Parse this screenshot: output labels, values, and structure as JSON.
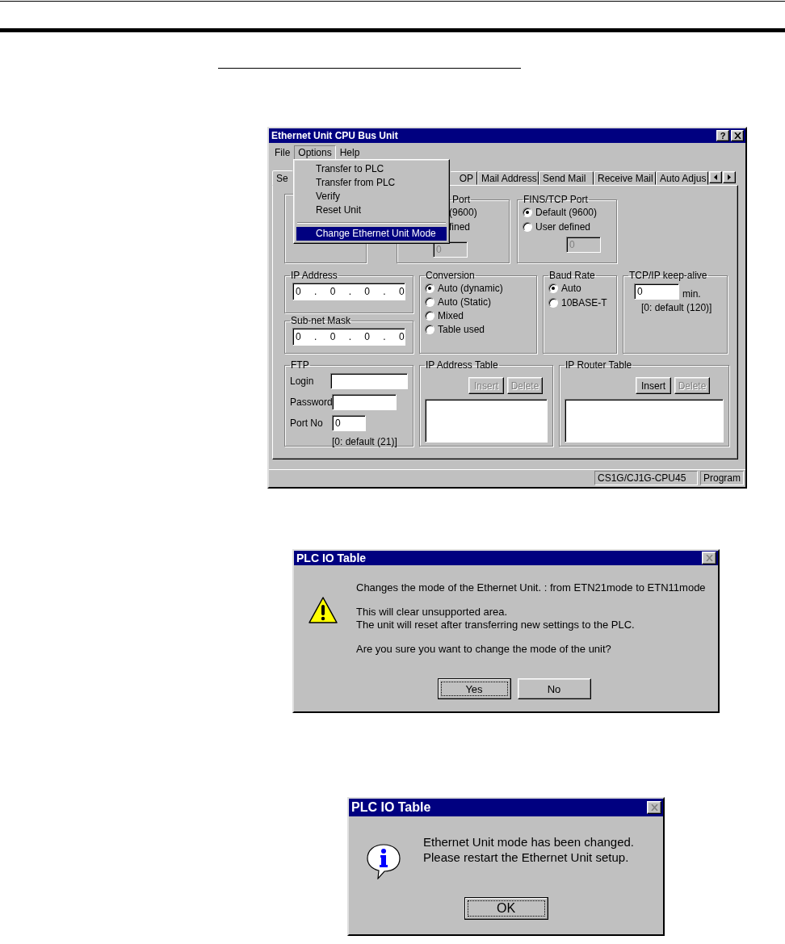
{
  "main_window": {
    "title": "Ethernet Unit CPU Bus Unit",
    "help_button": "?",
    "menu": [
      {
        "label": "File",
        "selected": false
      },
      {
        "label": "Options",
        "selected": true
      },
      {
        "label": "Help",
        "selected": false
      }
    ],
    "options_menu": [
      {
        "kind": "item",
        "label": "Transfer to PLC",
        "selected": false
      },
      {
        "kind": "item",
        "label": "Transfer from PLC",
        "selected": false
      },
      {
        "kind": "item",
        "label": "Verify",
        "selected": false
      },
      {
        "kind": "item",
        "label": "Reset Unit",
        "selected": false
      },
      {
        "kind": "separator"
      },
      {
        "kind": "item",
        "label": "Change Ethernet Unit Mode",
        "selected": true
      }
    ],
    "tabs": [
      {
        "label": "Se",
        "selected": true
      },
      {
        "label": "OP",
        "selected": false
      },
      {
        "label": "Mail Address",
        "selected": false
      },
      {
        "label": "Send Mail",
        "selected": false
      },
      {
        "label": "Receive Mail",
        "selected": false
      },
      {
        "label": "Auto Adjus",
        "selected": false
      }
    ],
    "port_group": {
      "label": "Port",
      "options": [
        "(9600)",
        "fined"
      ],
      "field": {
        "value": "0",
        "disabled": true
      }
    },
    "fins_tcp_port": {
      "label": "FINS/TCP Port",
      "options": [
        {
          "label": "Default (9600)",
          "checked": true
        },
        {
          "label": "User defined",
          "checked": false
        }
      ],
      "field": {
        "value": "0",
        "disabled": true
      }
    },
    "ip_address": {
      "label": "IP Address",
      "value": "0 . 0 . 0 . 0"
    },
    "subnet_mask": {
      "label": "Sub-net Mask",
      "value": "0 . 0 . 0 . 0"
    },
    "conversion": {
      "label": "Conversion",
      "options": [
        {
          "label": "Auto (dynamic)",
          "checked": true
        },
        {
          "label": "Auto (Static)",
          "checked": false
        },
        {
          "label": "Mixed",
          "checked": false
        },
        {
          "label": "Table used",
          "checked": false
        }
      ]
    },
    "baud_rate": {
      "label": "Baud Rate",
      "options": [
        {
          "label": "Auto",
          "checked": true
        },
        {
          "label": "10BASE-T",
          "checked": false
        }
      ]
    },
    "keep_alive": {
      "label": "TCP/IP keep-alive",
      "value": "0",
      "unit": "min.",
      "note": "[0: default (120)]"
    },
    "ftp": {
      "label": "FTP",
      "fields": [
        {
          "label": "Login"
        },
        {
          "label": "Password"
        },
        {
          "label": "Port No",
          "value": "0"
        }
      ],
      "note": "[0: default (21)]"
    },
    "ip_address_table": {
      "label": "IP Address Table",
      "buttons": [
        {
          "label": "Insert",
          "disabled": true
        },
        {
          "label": "Delete",
          "disabled": true
        }
      ]
    },
    "ip_router_table": {
      "label": "IP Router Table",
      "buttons": [
        {
          "label": "Insert",
          "disabled": false
        },
        {
          "label": "Delete",
          "disabled": true
        }
      ]
    },
    "status_bar": [
      "CS1G/CJ1G-CPU45",
      "Program"
    ]
  },
  "confirm_dialog": {
    "title": "PLC IO Table",
    "kind": "warning",
    "paragraphs": [
      [
        "Changes the mode of the Ethernet Unit. : from ETN21mode to ETN11mode"
      ],
      [
        "This will clear unsupported area.",
        "The unit will reset after transferring new settings to the PLC."
      ],
      [
        "Are you sure you want to change the mode of the unit?"
      ]
    ],
    "buttons": [
      {
        "label": "Yes",
        "focused": true
      },
      {
        "label": "No",
        "focused": false
      }
    ]
  },
  "info_dialog": {
    "title": "PLC IO Table",
    "kind": "info",
    "paragraphs": [
      [
        "Ethernet Unit mode has been changed.",
        "Please restart the Ethernet Unit setup."
      ]
    ],
    "buttons": [
      {
        "label": "OK",
        "focused": true
      }
    ]
  }
}
